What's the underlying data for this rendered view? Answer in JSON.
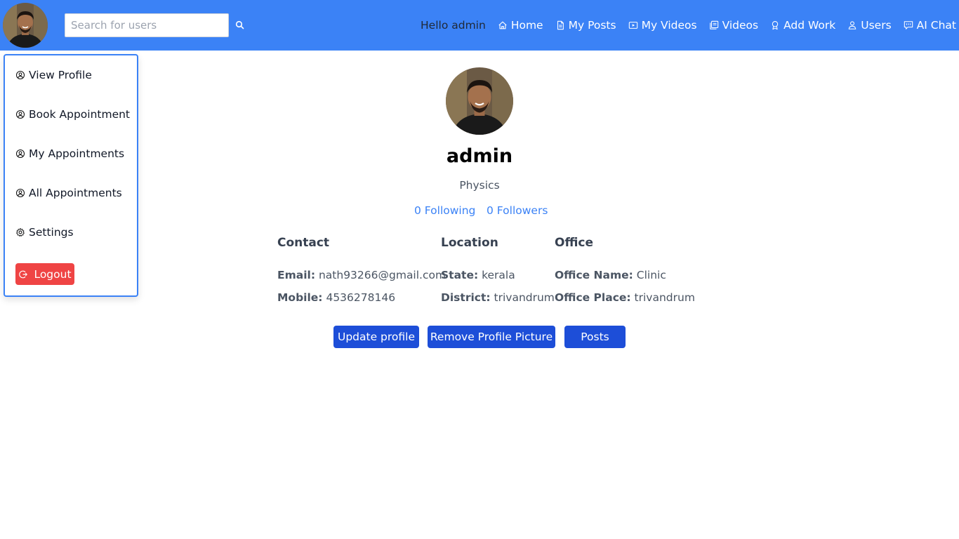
{
  "header": {
    "search": {
      "placeholder": "Search for users",
      "value": ""
    },
    "greeting": "Hello admin",
    "nav": [
      {
        "label": "Home",
        "icon": "home-icon"
      },
      {
        "label": "My Posts",
        "icon": "document-icon"
      },
      {
        "label": "My Videos",
        "icon": "video-icon"
      },
      {
        "label": "Videos",
        "icon": "gallery-icon"
      },
      {
        "label": "Add Work",
        "icon": "award-icon"
      },
      {
        "label": "Users",
        "icon": "users-icon"
      },
      {
        "label": "AI Chat",
        "icon": "chat-icon"
      }
    ]
  },
  "menu": {
    "items": [
      {
        "label": "View Profile",
        "icon": "user-circle-icon"
      },
      {
        "label": "Book Appointment",
        "icon": "user-circle-icon"
      },
      {
        "label": "My Appointments",
        "icon": "user-circle-icon"
      },
      {
        "label": "All Appointments",
        "icon": "user-circle-icon"
      },
      {
        "label": "Settings",
        "icon": "gear-icon"
      }
    ],
    "logout": "Logout"
  },
  "profile": {
    "name": "admin",
    "subject": "Physics",
    "following": "0 Following",
    "followers": "0 Followers",
    "contact": {
      "heading": "Contact",
      "email_label": "Email:",
      "email": "nath93266@gmail.com",
      "mobile_label": "Mobile:",
      "mobile": "4536278146"
    },
    "location": {
      "heading": "Location",
      "state_label": "State:",
      "state": "kerala",
      "district_label": "District:",
      "district": "trivandrum"
    },
    "office": {
      "heading": "Office",
      "name_label": "Office Name:",
      "name": "Clinic",
      "place_label": "Office Place:",
      "place": "trivandrum"
    },
    "buttons": {
      "update": "Update profile",
      "remove_picture": "Remove Profile Picture",
      "posts": "Posts"
    }
  },
  "colors": {
    "topbar": "#3b82f6",
    "primary_button": "#1d4ed8",
    "logout": "#ef4444",
    "link": "#3b82f6"
  }
}
